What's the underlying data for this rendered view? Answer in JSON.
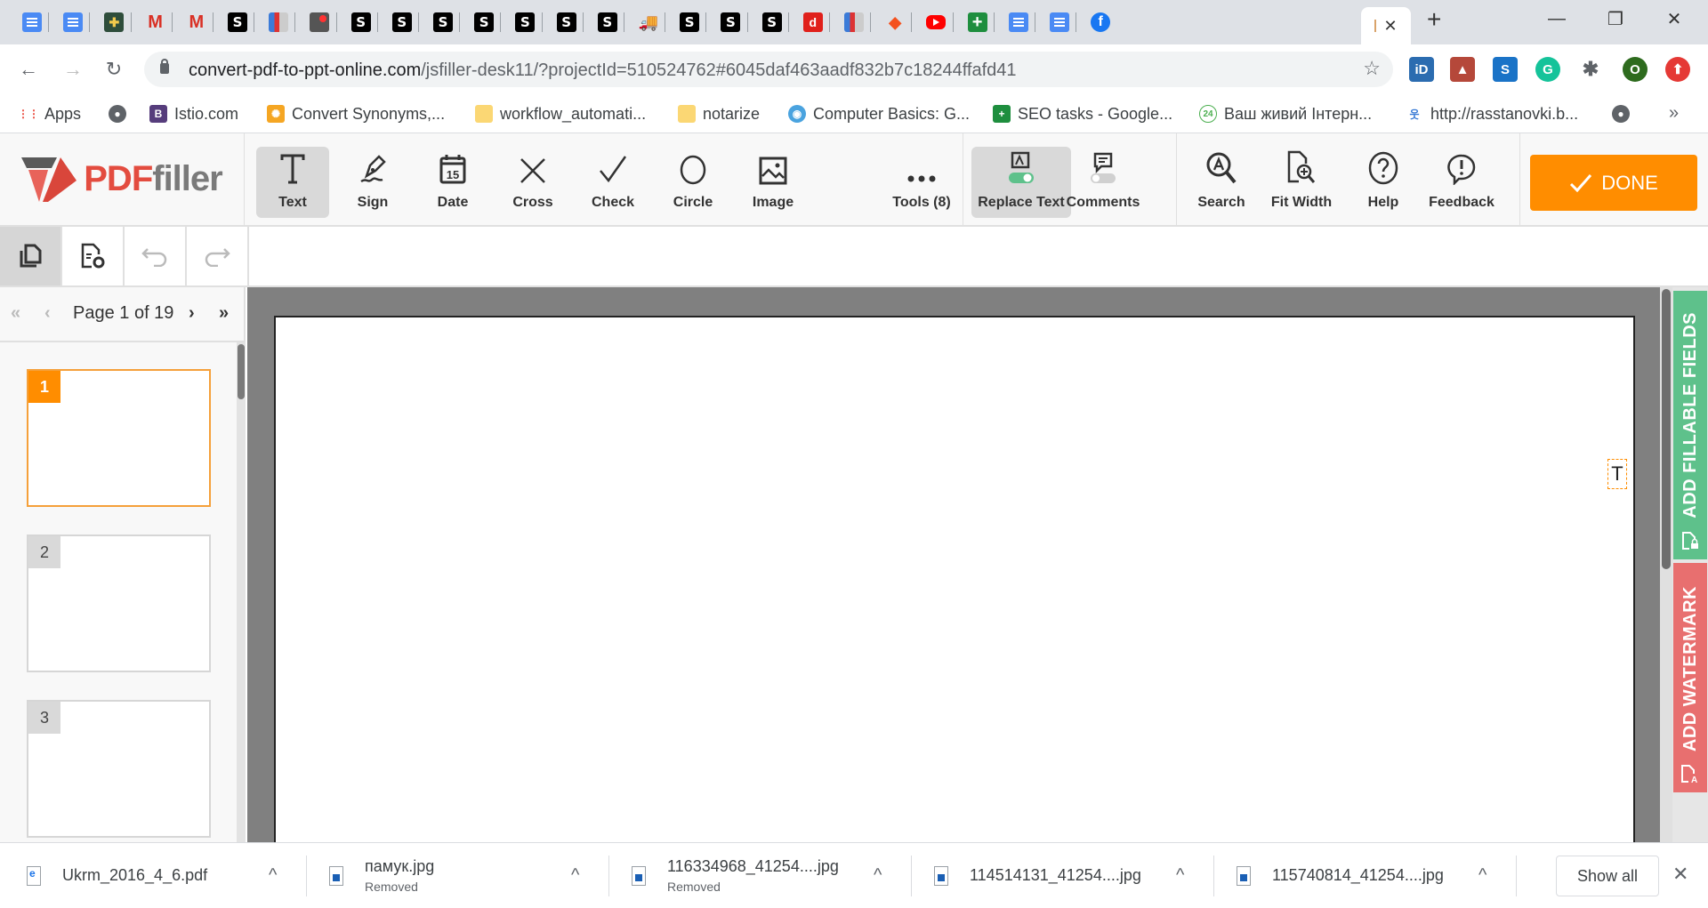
{
  "browser": {
    "tabs": [
      {
        "icon": "google-docs-icon",
        "glyph": ""
      },
      {
        "icon": "google-docs-icon",
        "glyph": ""
      },
      {
        "icon": "orthodox-cross-icon",
        "glyph": "✚"
      },
      {
        "icon": "gmail-icon",
        "glyph": "M"
      },
      {
        "icon": "gmail-icon",
        "glyph": "M"
      },
      {
        "icon": "s-site-icon",
        "glyph": "S"
      },
      {
        "icon": "books-icon",
        "glyph": ""
      },
      {
        "icon": "record-icon",
        "glyph": ""
      },
      {
        "icon": "s-site-icon",
        "glyph": "S"
      },
      {
        "icon": "s-site-icon",
        "glyph": "S"
      },
      {
        "icon": "s-site-icon",
        "glyph": "S"
      },
      {
        "icon": "s-site-icon",
        "glyph": "S"
      },
      {
        "icon": "s-site-icon",
        "glyph": "S"
      },
      {
        "icon": "s-site-icon",
        "glyph": "S"
      },
      {
        "icon": "s-site-icon",
        "glyph": "S"
      },
      {
        "icon": "delivery-truck-icon",
        "glyph": "🚚"
      },
      {
        "icon": "s-site-icon",
        "glyph": "S"
      },
      {
        "icon": "s-site-icon",
        "glyph": "S"
      },
      {
        "icon": "s-site-icon",
        "glyph": "S"
      },
      {
        "icon": "d-site-icon",
        "glyph": "d"
      },
      {
        "icon": "books-icon",
        "glyph": ""
      },
      {
        "icon": "australia-map-icon",
        "glyph": "◆"
      },
      {
        "icon": "youtube-icon",
        "glyph": ""
      },
      {
        "icon": "google-sheets-icon",
        "glyph": "+"
      },
      {
        "icon": "google-docs-icon",
        "glyph": ""
      },
      {
        "icon": "google-docs-icon",
        "glyph": ""
      },
      {
        "icon": "facebook-icon",
        "glyph": "f"
      }
    ],
    "active_tab_close": "✕",
    "new_tab": "+",
    "window": {
      "minimize": "—",
      "restore": "❐",
      "close": "✕"
    },
    "nav": {
      "back": "←",
      "forward": "→",
      "reload": "↻"
    },
    "url": {
      "domain": "convert-pdf-to-ppt-online.com",
      "path": "/jsfiller-desk11/?projectId=510524762#6045daf463aadf832b7c18244ffafd41"
    },
    "bookmark_star": "☆",
    "extensions": [
      {
        "name": "id-extension",
        "label": "iD",
        "color": "#2b6cb0"
      },
      {
        "name": "triangle-extension",
        "label": "▲",
        "color": "#b5483a"
      },
      {
        "name": "s-extension",
        "label": "S",
        "color": "#1a73c7"
      },
      {
        "name": "grammarly-extension",
        "label": "G",
        "color": "#15c39a"
      },
      {
        "name": "puzzle-extension",
        "label": "✱",
        "color": "#5f6368"
      },
      {
        "name": "profile-avatar",
        "label": "O",
        "color": "#2e6b1e"
      },
      {
        "name": "upload-extension",
        "label": "⬆",
        "color": "#e53935"
      }
    ],
    "bookmarks": [
      {
        "label": "Apps",
        "icon": "apps-grid-icon"
      },
      {
        "label": "",
        "icon": "globe-icon"
      },
      {
        "label": "Istio.com",
        "icon": "bootstrap-icon"
      },
      {
        "label": "Convert Synonyms,...",
        "icon": "sunburst-icon"
      },
      {
        "label": "workflow_automati...",
        "icon": "folder-icon"
      },
      {
        "label": "notarize",
        "icon": "folder-icon"
      },
      {
        "label": "Computer Basics: G...",
        "icon": "globe-color-icon"
      },
      {
        "label": "SEO tasks - Google...",
        "icon": "google-sheets-icon"
      },
      {
        "label": "Ваш живий Інтерн...",
        "icon": "24-badge-icon"
      },
      {
        "label": "http://rasstanovki.b...",
        "icon": "people-icon"
      },
      {
        "label": "",
        "icon": "globe-icon"
      }
    ],
    "bookmarks_overflow": "»"
  },
  "app": {
    "logo": {
      "part1": "PDF",
      "part2": "filler"
    },
    "tools": [
      {
        "label": "Text",
        "icon": "text-tool-icon",
        "active": true
      },
      {
        "label": "Sign",
        "icon": "sign-pen-icon",
        "active": false
      },
      {
        "label": "Date",
        "icon": "calendar-icon",
        "active": false
      },
      {
        "label": "Cross",
        "icon": "cross-icon",
        "active": false
      },
      {
        "label": "Check",
        "icon": "checkmark-icon",
        "active": false
      },
      {
        "label": "Circle",
        "icon": "circle-icon",
        "active": false
      },
      {
        "label": "Image",
        "icon": "image-icon",
        "active": false
      },
      {
        "label": "Tools (8)",
        "icon": "more-dots-icon",
        "active": false
      },
      {
        "label": "Replace Text",
        "icon": "replace-text-icon",
        "active": true
      },
      {
        "label": "Comments",
        "icon": "comments-icon",
        "active": false
      },
      {
        "label": "Search",
        "icon": "search-icon",
        "active": false
      },
      {
        "label": "Fit Width",
        "icon": "fit-width-icon",
        "active": false
      },
      {
        "label": "Help",
        "icon": "help-icon",
        "active": false
      },
      {
        "label": "Feedback",
        "icon": "feedback-icon",
        "active": false
      }
    ],
    "done_label": "DONE",
    "calendar_day": "15",
    "pager": {
      "first": "«",
      "prev": "‹",
      "label": "Page 1 of 19",
      "next": "›",
      "last": "»"
    },
    "thumbnails": [
      {
        "number": "1",
        "active": true
      },
      {
        "number": "2",
        "active": false
      },
      {
        "number": "3",
        "active": false
      }
    ],
    "text_field_placeholder": "T",
    "side_tabs": {
      "fillable": "ADD FILLABLE FIELDS",
      "watermark": "ADD WATERMARK"
    },
    "colors": {
      "accent": "#ff8d00",
      "fillable": "#5ec18b",
      "watermark": "#e86f6f",
      "brand_red": "#e34c3f"
    }
  },
  "downloads": {
    "items": [
      {
        "name": "Ukrm_2016_4_6.pdf",
        "status": "",
        "type": "pdf"
      },
      {
        "name": "памук.jpg",
        "status": "Removed",
        "type": "jpg"
      },
      {
        "name": "116334968_41254....jpg",
        "status": "Removed",
        "type": "jpg"
      },
      {
        "name": "114514131_41254....jpg",
        "status": "",
        "type": "jpg"
      },
      {
        "name": "115740814_41254....jpg",
        "status": "",
        "type": "jpg"
      }
    ],
    "caret": "^",
    "show_all": "Show all",
    "close": "✕"
  }
}
